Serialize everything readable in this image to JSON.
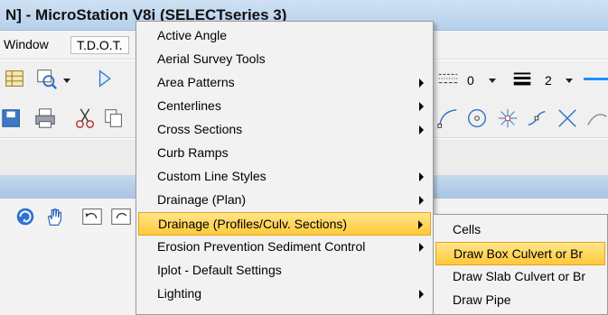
{
  "window": {
    "title": "N] - MicroStation V8i (SELECTseries 3)"
  },
  "menubar": {
    "items": [
      "Window",
      "T.D.O.T."
    ]
  },
  "toolbar": {
    "level_value": "0",
    "weight_value": "2",
    "accent_color": "#1e90ff"
  },
  "main_menu": {
    "items": [
      {
        "label": "Active Angle",
        "submenu": false
      },
      {
        "label": "Aerial Survey Tools",
        "submenu": false
      },
      {
        "label": "Area Patterns",
        "submenu": true
      },
      {
        "label": "Centerlines",
        "submenu": true
      },
      {
        "label": "Cross Sections",
        "submenu": true
      },
      {
        "label": "Curb Ramps",
        "submenu": false
      },
      {
        "label": "Custom Line Styles",
        "submenu": true
      },
      {
        "label": "Drainage (Plan)",
        "submenu": true
      },
      {
        "label": "Drainage (Profiles/Culv. Sections)",
        "submenu": true,
        "highlighted": true
      },
      {
        "label": "Erosion Prevention Sediment Control",
        "submenu": true
      },
      {
        "label": "Iplot -  Default Settings",
        "submenu": false
      },
      {
        "label": "Lighting",
        "submenu": true
      }
    ]
  },
  "sub_menu": {
    "items": [
      {
        "label": "Cells"
      },
      {
        "label": "Draw Box Culvert or Br",
        "highlighted": true
      },
      {
        "label": "Draw Slab Culvert or Br"
      },
      {
        "label": "Draw Pipe"
      }
    ]
  }
}
